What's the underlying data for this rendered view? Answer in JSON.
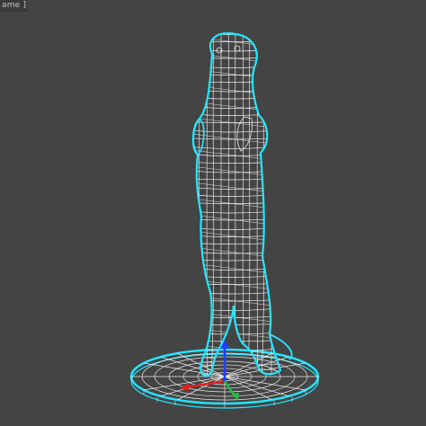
{
  "viewport": {
    "label": "ame ]",
    "wire_outline_color": "#22e6ff",
    "wire_inner_color": "#f2f2f2",
    "background_color": "#444444"
  },
  "gizmo": {
    "x_axis_color": "#e02020",
    "y_axis_color": "#20c040",
    "z_axis_color": "#2040ff"
  }
}
